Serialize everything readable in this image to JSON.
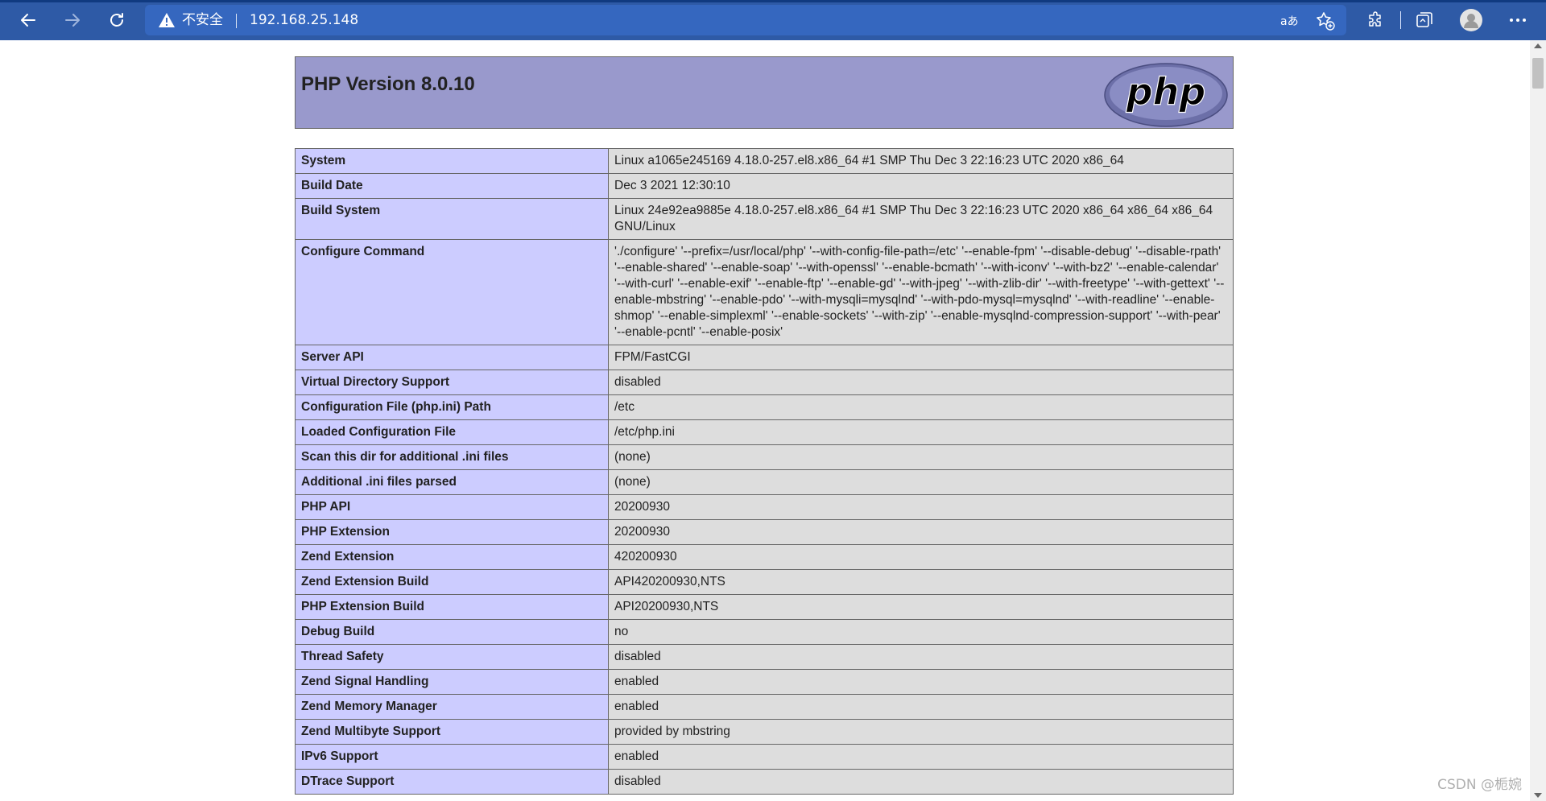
{
  "browser": {
    "security_label": "不安全",
    "url": "192.168.25.148",
    "colors": {
      "toolbar": "#2e5aa6",
      "omnibox": "#3567bf"
    },
    "icons": [
      "back-arrow-icon",
      "forward-arrow-icon",
      "refresh-icon",
      "warning-icon",
      "read-aloud-icon",
      "favorite-add-icon",
      "extensions-icon",
      "collections-icon",
      "profile-avatar-icon",
      "more-menu-icon"
    ]
  },
  "page": {
    "title": "PHP Version 8.0.10",
    "logo_text": "php",
    "colors": {
      "header": "#9999cc",
      "label_cell": "#ccccff",
      "value_cell": "#dddddd",
      "border": "#666666"
    },
    "rows": [
      {
        "label": "System",
        "value": "Linux a1065e245169 4.18.0-257.el8.x86_64 #1 SMP Thu Dec 3 22:16:23 UTC 2020 x86_64"
      },
      {
        "label": "Build Date",
        "value": "Dec 3 2021 12:30:10"
      },
      {
        "label": "Build System",
        "value": "Linux 24e92ea9885e 4.18.0-257.el8.x86_64 #1 SMP Thu Dec 3 22:16:23 UTC 2020 x86_64 x86_64 x86_64 GNU/Linux"
      },
      {
        "label": "Configure Command",
        "value": "'./configure' '--prefix=/usr/local/php' '--with-config-file-path=/etc' '--enable-fpm' '--disable-debug' '--disable-rpath' '--enable-shared' '--enable-soap' '--with-openssl' '--enable-bcmath' '--with-iconv' '--with-bz2' '--enable-calendar' '--with-curl' '--enable-exif' '--enable-ftp' '--enable-gd' '--with-jpeg' '--with-zlib-dir' '--with-freetype' '--with-gettext' '--enable-mbstring' '--enable-pdo' '--with-mysqli=mysqlnd' '--with-pdo-mysql=mysqlnd' '--with-readline' '--enable-shmop' '--enable-simplexml' '--enable-sockets' '--with-zip' '--enable-mysqlnd-compression-support' '--with-pear' '--enable-pcntl' '--enable-posix'"
      },
      {
        "label": "Server API",
        "value": "FPM/FastCGI"
      },
      {
        "label": "Virtual Directory Support",
        "value": "disabled"
      },
      {
        "label": "Configuration File (php.ini) Path",
        "value": "/etc"
      },
      {
        "label": "Loaded Configuration File",
        "value": "/etc/php.ini"
      },
      {
        "label": "Scan this dir for additional .ini files",
        "value": "(none)"
      },
      {
        "label": "Additional .ini files parsed",
        "value": "(none)"
      },
      {
        "label": "PHP API",
        "value": "20200930"
      },
      {
        "label": "PHP Extension",
        "value": "20200930"
      },
      {
        "label": "Zend Extension",
        "value": "420200930"
      },
      {
        "label": "Zend Extension Build",
        "value": "API420200930,NTS"
      },
      {
        "label": "PHP Extension Build",
        "value": "API20200930,NTS"
      },
      {
        "label": "Debug Build",
        "value": "no"
      },
      {
        "label": "Thread Safety",
        "value": "disabled"
      },
      {
        "label": "Zend Signal Handling",
        "value": "enabled"
      },
      {
        "label": "Zend Memory Manager",
        "value": "enabled"
      },
      {
        "label": "Zend Multibyte Support",
        "value": "provided by mbstring"
      },
      {
        "label": "IPv6 Support",
        "value": "enabled"
      },
      {
        "label": "DTrace Support",
        "value": "disabled"
      }
    ]
  },
  "watermark": "CSDN @栀婉"
}
